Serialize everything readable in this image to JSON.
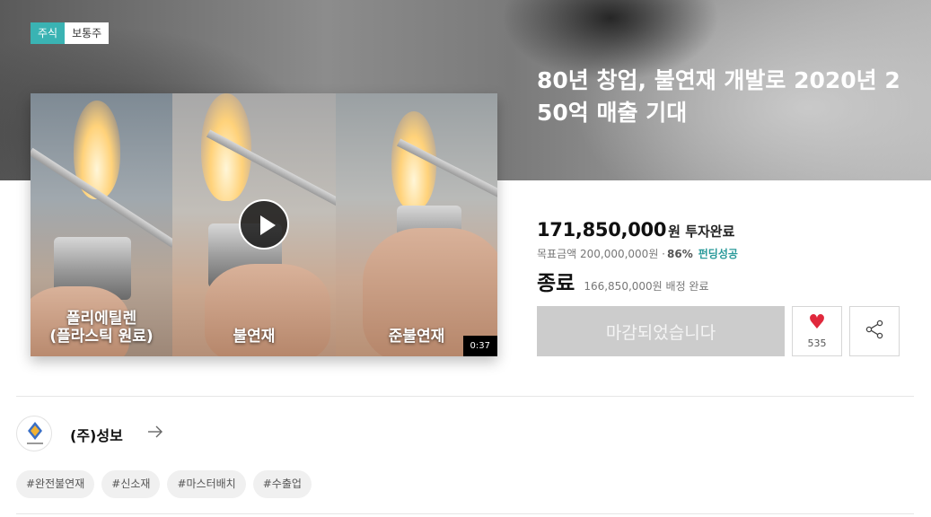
{
  "badges": {
    "type": "주식",
    "kind": "보통주"
  },
  "title": "80년 창업, 불연재 개발로 2020년 250억 매출 기대",
  "video": {
    "panels": [
      {
        "label": "폴리에틸렌\n(플라스틱 원료)"
      },
      {
        "label": "불연재"
      },
      {
        "label": "준불연재"
      }
    ],
    "duration": "0:37",
    "play_icon": "play-icon"
  },
  "funding": {
    "amount": "171,850,000",
    "amount_suffix": "원 투자완료",
    "goal_text": "목표금액 200,000,000원 · ",
    "goal_percent": "86%",
    "goal_status": "펀딩성공",
    "end_label": "종료",
    "allocation_note": "166,850,000원 배정 완료"
  },
  "actions": {
    "closed_label": "마감되었습니다",
    "like_count": "535",
    "like_icon": "heart-icon",
    "share_icon": "share-icon"
  },
  "company": {
    "name": "(주)성보",
    "arrow_icon": "arrow-right-icon"
  },
  "tags": [
    "#완전불연재",
    "#신소재",
    "#마스터배치",
    "#수출업"
  ],
  "colors": {
    "accent": "#3ab3b3",
    "success": "#2a9a9a",
    "like": "#e0283c",
    "disabled_button": "#cccccc"
  }
}
